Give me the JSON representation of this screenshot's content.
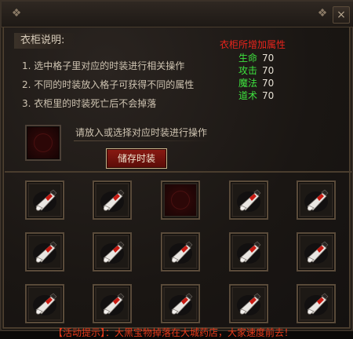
{
  "window": {
    "close_label": "×"
  },
  "description": {
    "title": "衣柜说明:",
    "lines": [
      "1. 选中格子里对应的时装进行相关操作",
      "2. 不同的时装放入格子可获得不同的属性",
      "3. 衣柜里的时装死亡后不会掉落"
    ]
  },
  "bonus": {
    "title": "衣柜所增加属性",
    "stats": [
      {
        "label": "生命",
        "value": "70"
      },
      {
        "label": "攻击",
        "value": "70"
      },
      {
        "label": "魔法",
        "value": "70"
      },
      {
        "label": "道术",
        "value": "70"
      }
    ],
    "label_color": "#3ee23e",
    "title_color": "#e8241c"
  },
  "preview": {
    "hint": "请放入或选择对应时装进行操作",
    "save_label": "储存时装"
  },
  "wardrobe": {
    "rows": [
      [
        "fashion-item",
        "fashion-item",
        "empty",
        "fashion-item",
        "fashion-item"
      ],
      [
        "fashion-item",
        "fashion-item",
        "fashion-item",
        "fashion-item",
        "fashion-item"
      ],
      [
        "fashion-item",
        "fashion-item",
        "fashion-item",
        "fashion-item",
        "fashion-item"
      ]
    ]
  },
  "bottom_note": "【活动提示】：大黑宝物掉落在大城药店，大家速度前去！"
}
